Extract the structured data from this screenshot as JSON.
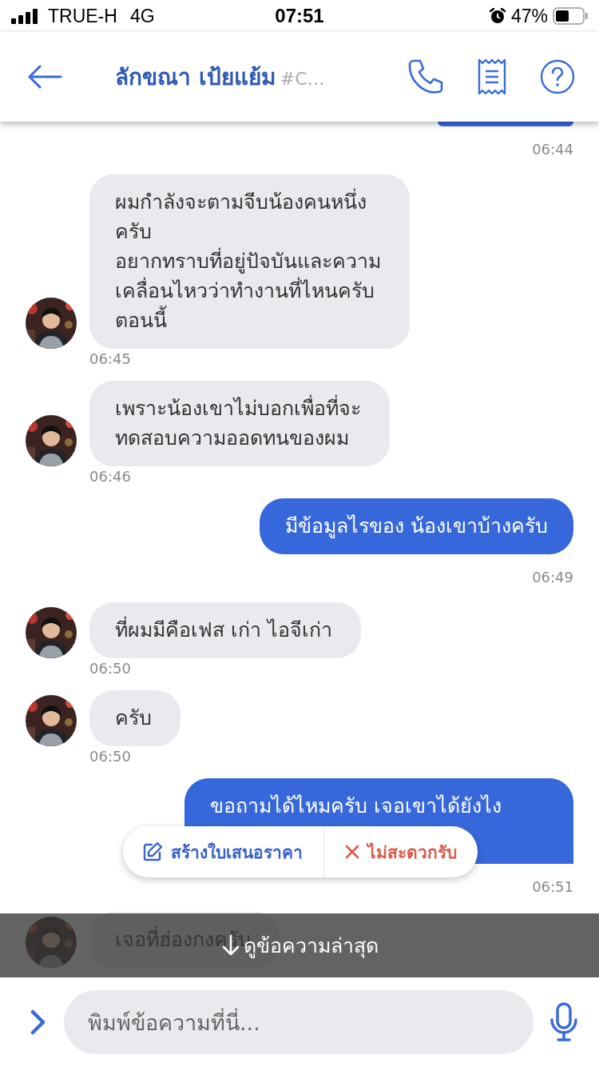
{
  "status_bar": {
    "carrier": "TRUE-H",
    "network": "4G",
    "time": "07:51",
    "battery": "47%"
  },
  "header": {
    "name": "ลักขณา เป้ยแย้ม",
    "tag": "#C…"
  },
  "messages": [
    {
      "kind": "outgoing_edge",
      "time": "06:44"
    },
    {
      "kind": "incoming",
      "text": "ผมกำลังจะตามจีบน้องคนหนึ่ง\nครับ\nอยากทราบที่อยู่ปัจบันและความ\nเคลื่อนไหวว่าทำงานที่ไหนครับ\nตอนนี้",
      "time": "06:45"
    },
    {
      "kind": "incoming",
      "text": "เพราะน้องเขาไม่บอกเพื่อที่จะ\nทดสอบความออดทนของผม",
      "time": "06:46"
    },
    {
      "kind": "outgoing",
      "text": "มีข้อมูลไรของ น้องเขาบ้างครับ",
      "time": "06:49"
    },
    {
      "kind": "incoming",
      "text": "ที่ผมมีคือเฟส เก่า ไอจีเก่า",
      "time": "06:50"
    },
    {
      "kind": "incoming",
      "text": "ครับ",
      "time": "06:50"
    },
    {
      "kind": "outgoing",
      "text": "ขอถามได้ไหมครับ เจอเขาได้ยังไง",
      "time": "06:51",
      "actions": [
        {
          "kind": "create",
          "label": "สร้างใบเสนอราคา"
        },
        {
          "kind": "decline",
          "label": "ไม่สะดวกรับ"
        }
      ]
    },
    {
      "kind": "incoming",
      "text": "เจอที่ฮ่องกงครับ"
    }
  ],
  "new_messages_bar": {
    "label": "ดูข้อความล่าสุด"
  },
  "composer": {
    "placeholder": "พิมพ์ข้อความที่นี่..."
  }
}
